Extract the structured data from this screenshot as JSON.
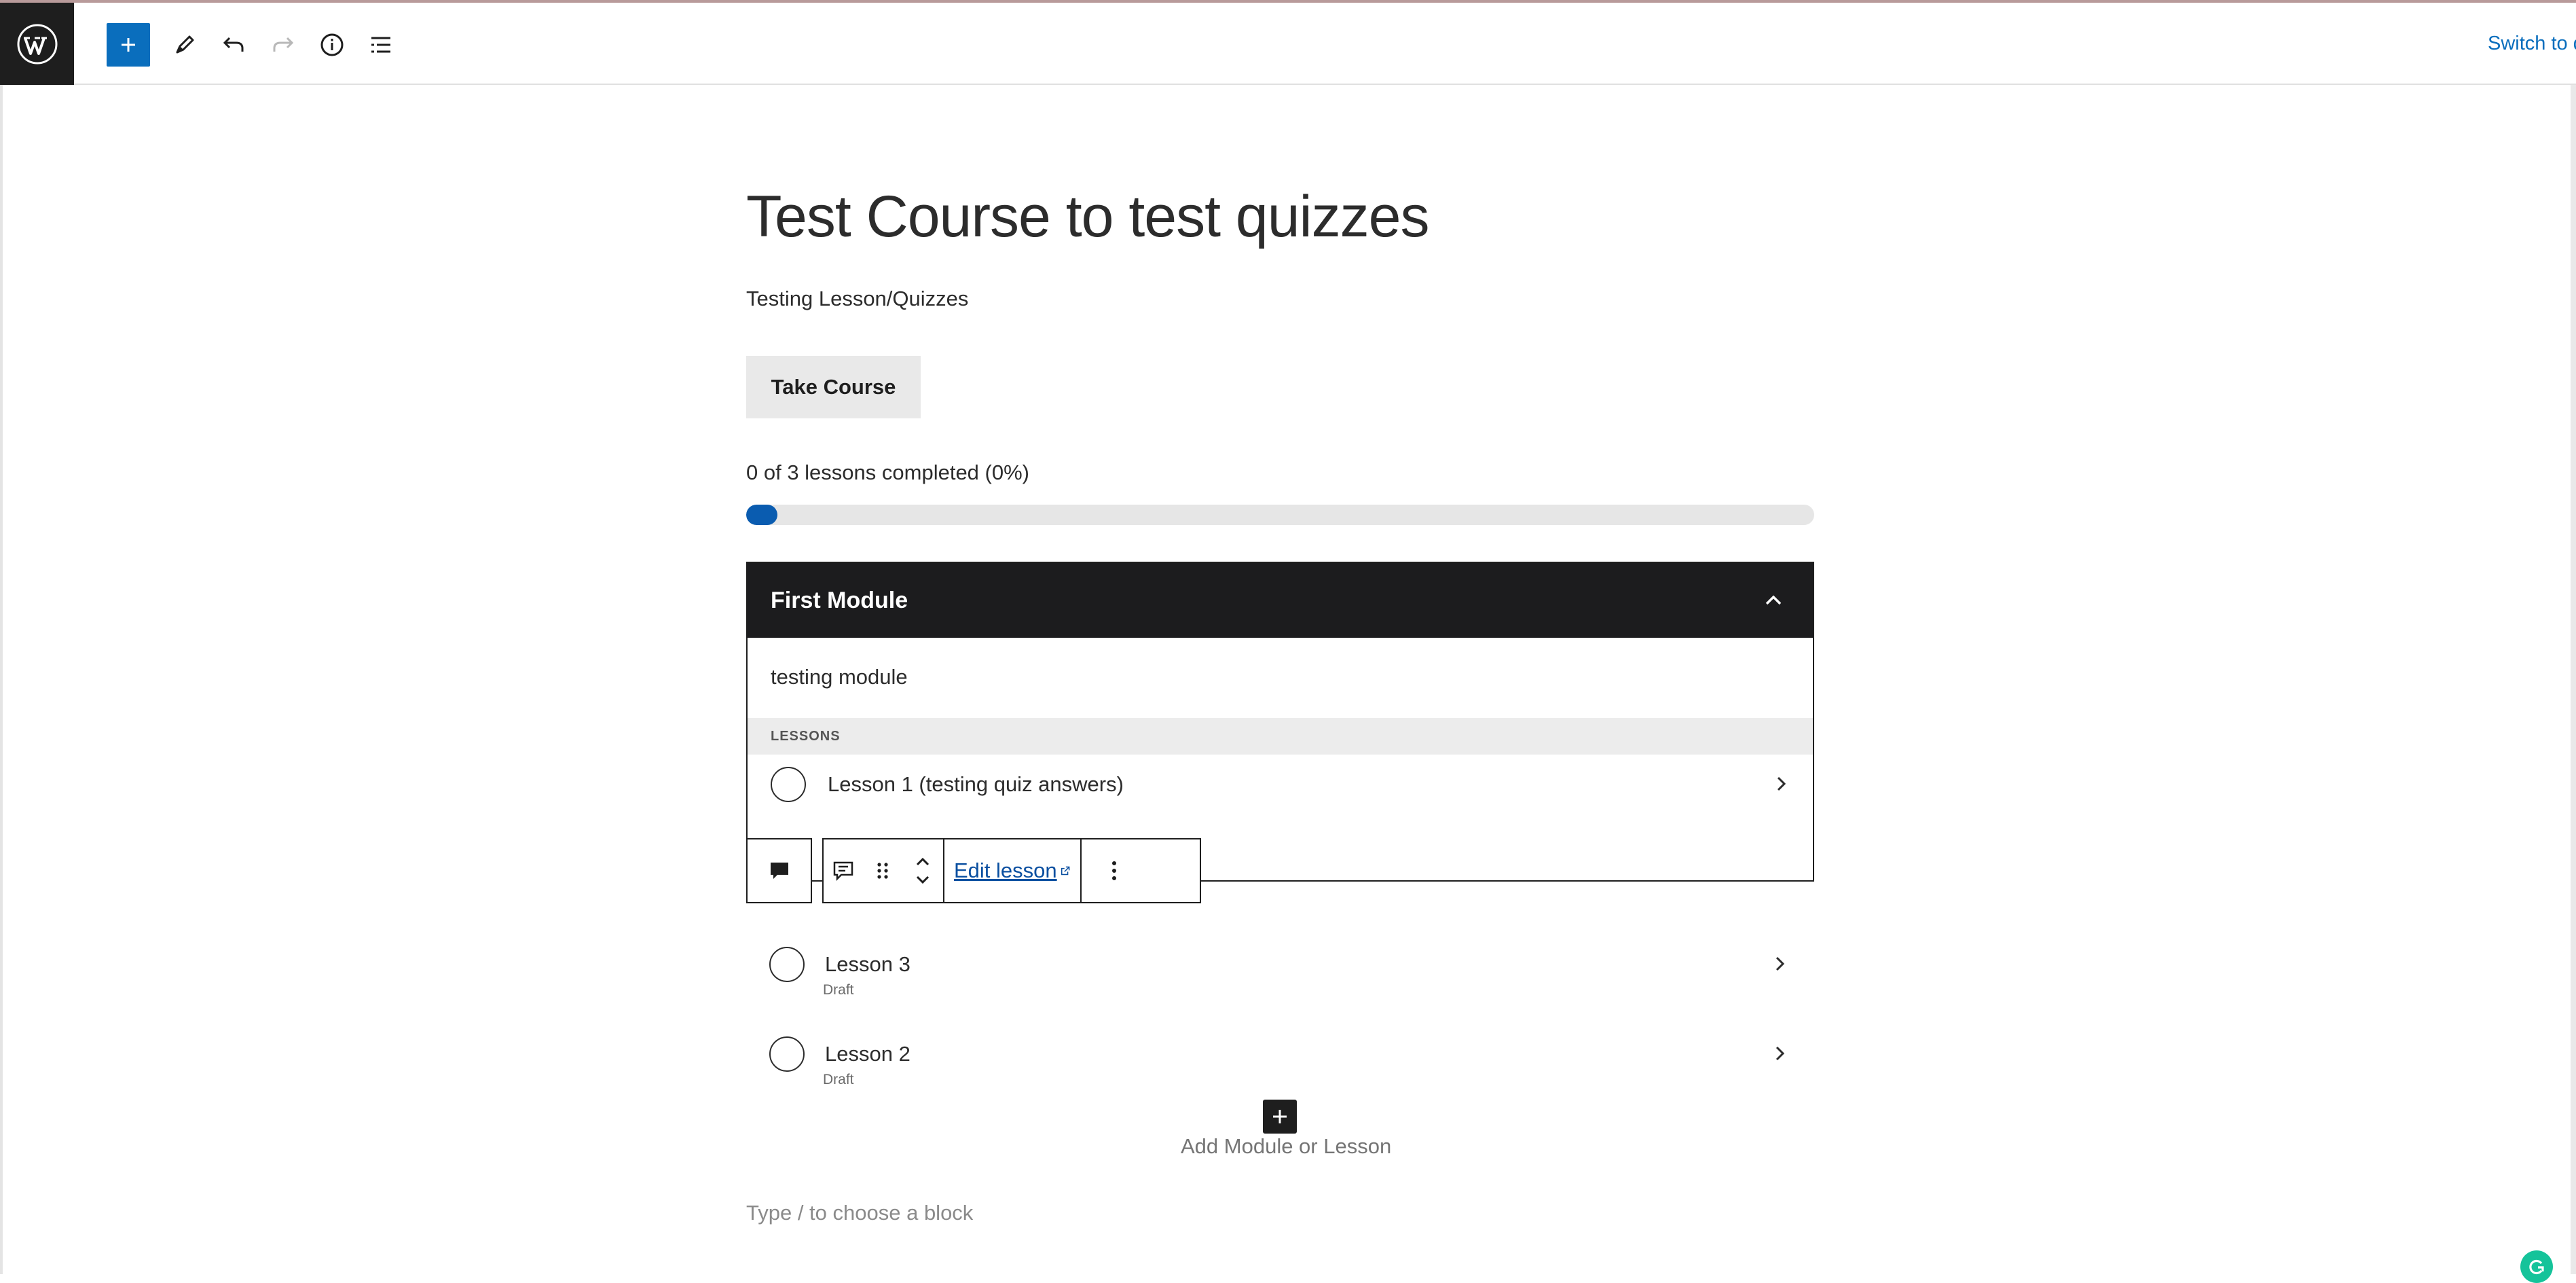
{
  "toolbar": {
    "logo_icon": "wordpress-logo-icon",
    "add_block_icon": "plus-icon",
    "tools_icon": "pencil-icon",
    "undo_icon": "undo-icon",
    "redo_icon": "redo-icon",
    "details_icon": "info-icon",
    "list_view_icon": "list-view-icon",
    "switch_label": "Switch to draft",
    "accent_color": "#0a6ebd"
  },
  "course": {
    "title": "Test Course to test quizzes",
    "subtitle": "Testing Lesson/Quizzes",
    "take_course_label": "Take Course",
    "progress_text": "0 of 3 lessons completed (0%)",
    "progress_percent": 0
  },
  "module": {
    "title": "First Module",
    "collapse_icon": "chevron-up-icon",
    "description": "testing module",
    "lessons_header": "LESSONS",
    "lessons": [
      {
        "label": "Lesson 1 (testing quiz answers)",
        "status": ""
      },
      {
        "label": "Lesson 3",
        "status": "Draft"
      },
      {
        "label": "Lesson 2",
        "status": "Draft"
      }
    ]
  },
  "block_toolbar": {
    "block_type_icon": "lesson-block-icon",
    "transform_icon": "lesson-icon",
    "drag_icon": "drag-handle-icon",
    "move_up_icon": "chevron-up-icon",
    "move_down_icon": "chevron-down-icon",
    "edit_lesson_label": "Edit lesson",
    "external_icon": "external-link-icon",
    "options_icon": "more-vertical-icon"
  },
  "add_block": {
    "label": "Add Module or Lesson",
    "icon": "plus-icon"
  },
  "editor": {
    "placeholder": "Type / to choose a block"
  }
}
